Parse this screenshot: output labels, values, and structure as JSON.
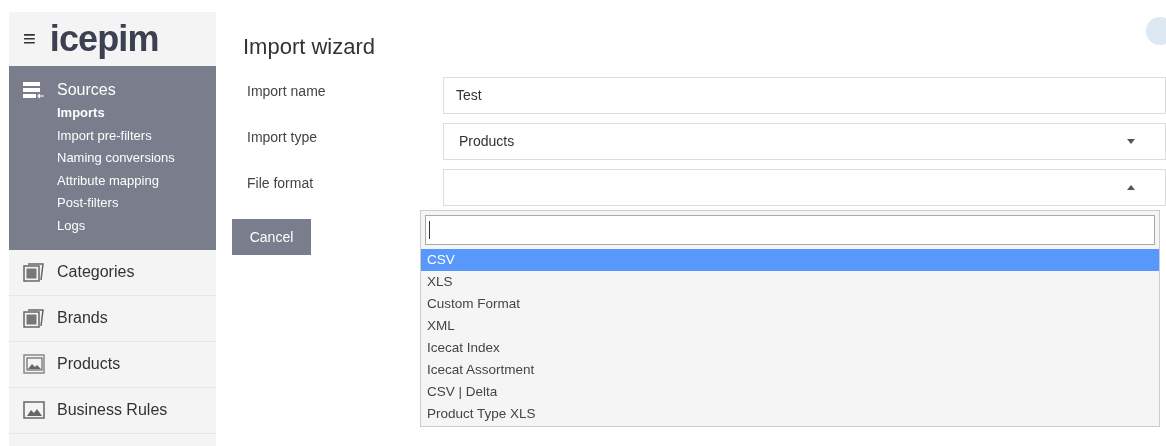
{
  "logo": {
    "menu_glyph": "≡",
    "text": "icepim"
  },
  "sidebar": {
    "items": [
      {
        "label": "Sources",
        "kind": "sources",
        "expanded": true,
        "children": [
          {
            "label": "Imports",
            "selected": true
          },
          {
            "label": "Import pre-filters",
            "selected": false
          },
          {
            "label": "Naming conversions",
            "selected": false
          },
          {
            "label": "Attribute mapping",
            "selected": false
          },
          {
            "label": "Post-filters",
            "selected": false
          },
          {
            "label": "Logs",
            "selected": false
          }
        ]
      },
      {
        "label": "Categories",
        "kind": "stack",
        "expanded": false
      },
      {
        "label": "Brands",
        "kind": "stack",
        "expanded": false
      },
      {
        "label": "Products",
        "kind": "image",
        "expanded": false
      },
      {
        "label": "Business Rules",
        "kind": "rules",
        "expanded": false
      }
    ]
  },
  "title": "Import wizard",
  "form": {
    "fields": [
      {
        "label": "Import name",
        "kind": "text",
        "value": "Test"
      },
      {
        "label": "Import type",
        "kind": "select",
        "value": "Products",
        "expanded": false
      },
      {
        "label": "File format",
        "kind": "select",
        "expanded": true
      }
    ]
  },
  "dropdown": {
    "options": [
      {
        "label": "CSV",
        "selected": true
      },
      {
        "label": "XLS",
        "selected": false
      },
      {
        "label": "Custom Format",
        "selected": false
      },
      {
        "label": "XML",
        "selected": false
      },
      {
        "label": "Icecat Index",
        "selected": false
      },
      {
        "label": "Icecat Assortment",
        "selected": false
      },
      {
        "label": "CSV | Delta",
        "selected": false
      },
      {
        "label": "Product Type XLS",
        "selected": false
      }
    ]
  },
  "buttons": [
    {
      "label": "Cancel"
    }
  ]
}
